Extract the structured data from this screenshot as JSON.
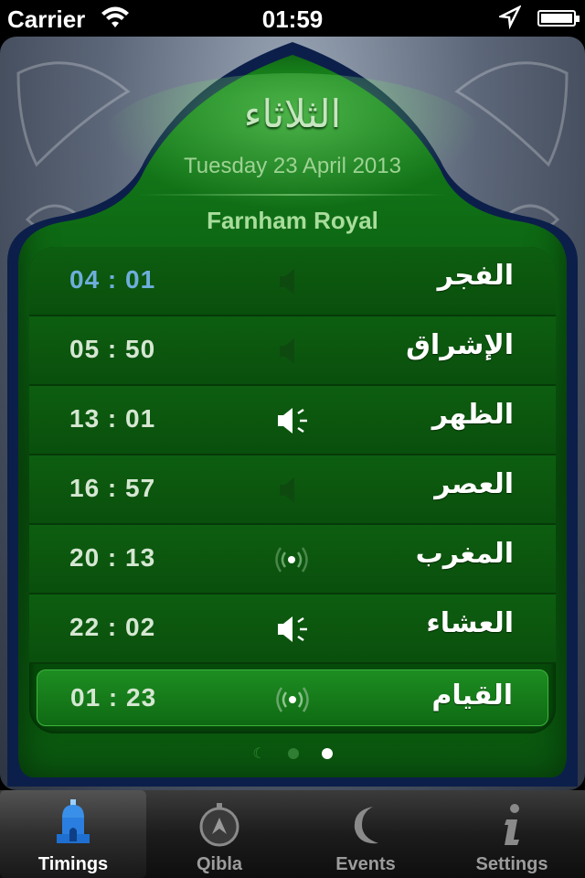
{
  "status_bar": {
    "carrier": "Carrier",
    "time": "01:59",
    "wifi_icon": "wifi-icon",
    "location_icon": "location-arrow-icon",
    "battery_icon": "battery-icon"
  },
  "header": {
    "day_arabic": "الثلاثاء",
    "date": "Tuesday 23 April 2013",
    "location": "Farnham Royal"
  },
  "prayers": [
    {
      "name": "الفجر",
      "time": "04 : 01",
      "icon": "speaker-muted-icon",
      "next": true
    },
    {
      "name": "الإشراق",
      "time": "05 : 50",
      "icon": "speaker-muted-icon"
    },
    {
      "name": "الظهر",
      "time": "13 : 01",
      "icon": "speaker-on-icon"
    },
    {
      "name": "العصر",
      "time": "16 : 57",
      "icon": "speaker-muted-icon"
    },
    {
      "name": "المغرب",
      "time": "20 : 13",
      "icon": "radio-wave-icon"
    },
    {
      "name": "العشاء",
      "time": "22 : 02",
      "icon": "speaker-on-icon"
    },
    {
      "name": "القيام",
      "time": "01 : 23",
      "icon": "radio-wave-icon",
      "current": true
    }
  ],
  "page_indicator": {
    "count": 3,
    "active": 3
  },
  "tabs": [
    {
      "label": "Timings",
      "icon": "mosque-icon",
      "active": true
    },
    {
      "label": "Qibla",
      "icon": "compass-icon"
    },
    {
      "label": "Events",
      "icon": "crescent-icon"
    },
    {
      "label": "Settings",
      "icon": "info-icon"
    }
  ],
  "colors": {
    "green_dark": "#0a4d0c",
    "green_light": "#1a8a1e",
    "next_time": "#6eaedb",
    "frame_blue": "#0c1f4a"
  }
}
